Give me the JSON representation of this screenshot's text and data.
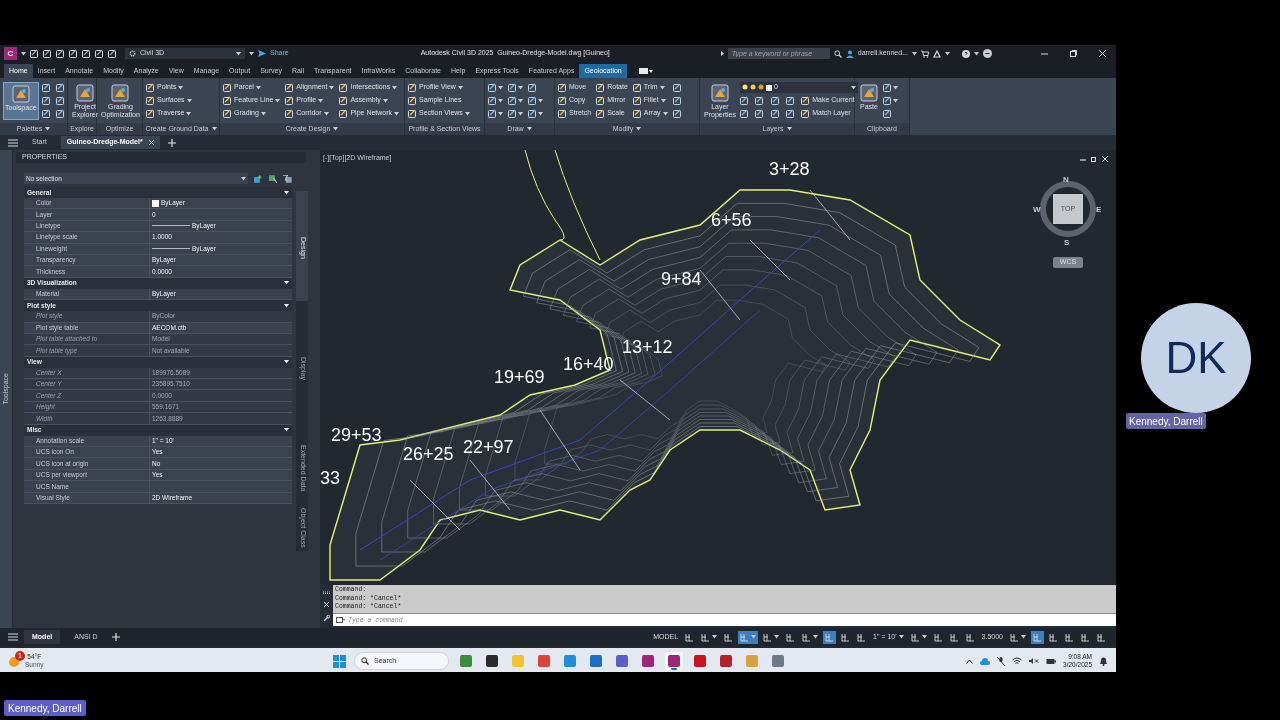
{
  "window": {
    "app_logo": "C",
    "workspace": "Civil 3D",
    "share": "Share",
    "title": "Autodesk Civil 3D 2025  Guineo-Dredge-Model.dwg [Guineo]",
    "search_placeholder": "Type a keyword or phrase",
    "user": "darrell.kenned..."
  },
  "ribbon_tabs": [
    {
      "label": "Home",
      "selected": true,
      "kind": "normal"
    },
    {
      "label": "Insert",
      "selected": false,
      "kind": "normal"
    },
    {
      "label": "Annotate",
      "selected": false,
      "kind": "normal"
    },
    {
      "label": "Modify",
      "selected": false,
      "kind": "normal"
    },
    {
      "label": "Analyze",
      "selected": false,
      "kind": "normal"
    },
    {
      "label": "View",
      "selected": false,
      "kind": "normal"
    },
    {
      "label": "Manage",
      "selected": false,
      "kind": "normal"
    },
    {
      "label": "Output",
      "selected": false,
      "kind": "normal"
    },
    {
      "label": "Survey",
      "selected": false,
      "kind": "normal"
    },
    {
      "label": "Rail",
      "selected": false,
      "kind": "normal"
    },
    {
      "label": "Transparent",
      "selected": false,
      "kind": "normal"
    },
    {
      "label": "InfraWorks",
      "selected": false,
      "kind": "normal"
    },
    {
      "label": "Collaborate",
      "selected": false,
      "kind": "normal"
    },
    {
      "label": "Help",
      "selected": false,
      "kind": "normal"
    },
    {
      "label": "Express Tools",
      "selected": false,
      "kind": "normal"
    },
    {
      "label": "Featured Apps",
      "selected": false,
      "kind": "normal"
    },
    {
      "label": "Geolocation",
      "selected": false,
      "kind": "contextual"
    }
  ],
  "ribbon_panels": [
    {
      "title": "Palettes",
      "dropdown": true,
      "kind": "tools",
      "large": [
        {
          "label": "Toolspace",
          "active": true
        }
      ],
      "items": [
        {
          "kind": "icon",
          "dropdown": false
        },
        {
          "kind": "icon",
          "dropdown": false
        },
        {
          "kind": "icon",
          "dropdown": false
        },
        {
          "kind": "icon",
          "dropdown": false
        },
        {
          "kind": "icon",
          "dropdown": false
        },
        {
          "kind": "icon",
          "dropdown": false
        }
      ]
    },
    {
      "title": "Explore",
      "dropdown": false,
      "kind": "tools",
      "large": [
        {
          "label": "Project Explorer",
          "active": false
        }
      ]
    },
    {
      "title": "Optimize",
      "dropdown": false,
      "kind": "tools",
      "large": [
        {
          "label": "Grading Optimization",
          "active": false
        }
      ]
    },
    {
      "title": "Create Ground Data",
      "dropdown": true,
      "kind": "tools",
      "items": [
        {
          "kind": "text",
          "label": "Points",
          "dropdown": true
        },
        {
          "kind": "text",
          "label": "Surfaces",
          "dropdown": true
        },
        {
          "kind": "text",
          "label": "Traverse",
          "dropdown": true
        }
      ]
    },
    {
      "title": "Create Design",
      "dropdown": true,
      "kind": "tools",
      "items": [
        {
          "kind": "text",
          "label": "Parcel",
          "dropdown": true
        },
        {
          "kind": "text",
          "label": "Feature Line",
          "dropdown": true
        },
        {
          "kind": "text",
          "label": "Grading",
          "dropdown": true
        },
        {
          "kind": "text",
          "label": "Alignment",
          "dropdown": true
        },
        {
          "kind": "text",
          "label": "Profile",
          "dropdown": true
        },
        {
          "kind": "text",
          "label": "Corridor",
          "dropdown": true
        },
        {
          "kind": "text",
          "label": "Intersections",
          "dropdown": true
        },
        {
          "kind": "text",
          "label": "Assembly",
          "dropdown": true
        },
        {
          "kind": "text",
          "label": "Pipe Network",
          "dropdown": true
        }
      ]
    },
    {
      "title": "Profile & Section Views",
      "dropdown": false,
      "kind": "tools",
      "items": [
        {
          "kind": "text",
          "label": "Profile View",
          "dropdown": true
        },
        {
          "kind": "text",
          "label": "Sample Lines",
          "dropdown": false
        },
        {
          "kind": "text",
          "label": "Section Views",
          "dropdown": true
        }
      ]
    },
    {
      "title": "Draw",
      "dropdown": true,
      "kind": "tools",
      "items": [
        {
          "kind": "icon",
          "dropdown": true
        },
        {
          "kind": "icon",
          "dropdown": true
        },
        {
          "kind": "icon",
          "dropdown": true
        },
        {
          "kind": "icon",
          "dropdown": true
        },
        {
          "kind": "icon",
          "dropdown": true
        },
        {
          "kind": "icon",
          "dropdown": true
        },
        {
          "kind": "icon",
          "dropdown": false
        },
        {
          "kind": "icon",
          "dropdown": true
        },
        {
          "kind": "icon",
          "dropdown": true
        }
      ]
    },
    {
      "title": "Modify",
      "dropdown": true,
      "kind": "tools",
      "items": [
        {
          "kind": "text",
          "label": "Move",
          "dropdown": false
        },
        {
          "kind": "text",
          "label": "Copy",
          "dropdown": false
        },
        {
          "kind": "text",
          "label": "Stretch",
          "dropdown": false
        },
        {
          "kind": "text",
          "label": "Rotate",
          "dropdown": false
        },
        {
          "kind": "text",
          "label": "Mirror",
          "dropdown": false
        },
        {
          "kind": "text",
          "label": "Scale",
          "dropdown": false
        },
        {
          "kind": "text",
          "label": "Trim",
          "dropdown": true
        },
        {
          "kind": "text",
          "label": "Fillet",
          "dropdown": true
        },
        {
          "kind": "text",
          "label": "Array",
          "dropdown": true
        },
        {
          "kind": "icon",
          "dropdown": false
        },
        {
          "kind": "icon",
          "dropdown": false
        },
        {
          "kind": "icon",
          "dropdown": false
        }
      ]
    },
    {
      "title": "Layers",
      "dropdown": true,
      "kind": "layers",
      "combo": "0",
      "large": [
        {
          "label": "Layer Properties",
          "active": false
        }
      ],
      "items": [
        {
          "kind": "icon",
          "dropdown": false
        },
        {
          "kind": "icon",
          "dropdown": false
        },
        {
          "kind": "icon",
          "dropdown": false
        },
        {
          "kind": "icon",
          "dropdown": false
        },
        {
          "kind": "icon",
          "dropdown": false
        },
        {
          "kind": "icon",
          "dropdown": false
        },
        {
          "kind": "icon",
          "dropdown": false
        },
        {
          "kind": "icon",
          "dropdown": false
        },
        {
          "kind": "text",
          "label": "Make Current",
          "dropdown": false
        },
        {
          "kind": "text",
          "label": "Match Layer",
          "dropdown": false
        }
      ]
    },
    {
      "title": "Clipboard",
      "dropdown": false,
      "kind": "tools",
      "large": [
        {
          "label": "Paste",
          "active": false
        }
      ],
      "items": [
        {
          "kind": "icon",
          "dropdown": true
        },
        {
          "kind": "icon",
          "dropdown": true
        },
        {
          "kind": "icon",
          "dropdown": false
        }
      ]
    }
  ],
  "file_tabs": [
    {
      "label": "Start",
      "selected": false
    },
    {
      "label": "Guineo-Dredge-Model*",
      "selected": true
    }
  ],
  "toolspace_label": "Toolspace",
  "properties": {
    "title": "PROPERTIES",
    "selection": "No selection",
    "sections": [
      {
        "title": "General",
        "rows": [
          {
            "name": "Color",
            "value": "ByLayer",
            "kind": "color",
            "disabled": false
          },
          {
            "name": "Layer",
            "value": "0",
            "kind": "text",
            "disabled": false
          },
          {
            "name": "Linetype",
            "value": "ByLayer",
            "kind": "line",
            "disabled": false
          },
          {
            "name": "Linetype scale",
            "value": "1.0000",
            "kind": "text",
            "disabled": false
          },
          {
            "name": "Lineweight",
            "value": "ByLayer",
            "kind": "line",
            "disabled": false
          },
          {
            "name": "Transparency",
            "value": "ByLayer",
            "kind": "text",
            "disabled": false
          },
          {
            "name": "Thickness",
            "value": "0.0000",
            "kind": "text",
            "disabled": false
          }
        ]
      },
      {
        "title": "3D Visualization",
        "rows": [
          {
            "name": "Material",
            "value": "ByLayer",
            "kind": "text",
            "disabled": false
          }
        ]
      },
      {
        "title": "Plot style",
        "rows": [
          {
            "name": "Plot style",
            "value": "ByColor",
            "kind": "text",
            "disabled": true
          },
          {
            "name": "Plot style table",
            "value": "AECOM.ctb",
            "kind": "text",
            "disabled": false
          },
          {
            "name": "Plot table attached to",
            "value": "Model",
            "kind": "text",
            "disabled": true
          },
          {
            "name": "Plot table type",
            "value": "Not available",
            "kind": "text",
            "disabled": true
          }
        ]
      },
      {
        "title": "View",
        "rows": [
          {
            "name": "Center X",
            "value": "189976.5089",
            "kind": "text",
            "disabled": true
          },
          {
            "name": "Center Y",
            "value": "235895.7510",
            "kind": "text",
            "disabled": true
          },
          {
            "name": "Center Z",
            "value": "0.0000",
            "kind": "text",
            "disabled": true
          },
          {
            "name": "Height",
            "value": "559.1671",
            "kind": "text",
            "disabled": true
          },
          {
            "name": "Width",
            "value": "1263.8889",
            "kind": "text",
            "disabled": true
          }
        ]
      },
      {
        "title": "Misc",
        "rows": [
          {
            "name": "Annotation scale",
            "value": "1\" = 10'",
            "kind": "text",
            "disabled": false
          },
          {
            "name": "UCS icon On",
            "value": "Yes",
            "kind": "text",
            "disabled": false
          },
          {
            "name": "UCS icon at origin",
            "value": "No",
            "kind": "text",
            "disabled": false
          },
          {
            "name": "UCS per viewport",
            "value": "Yes",
            "kind": "text",
            "disabled": false
          },
          {
            "name": "UCS Name",
            "kind": "text",
            "disabled": false
          },
          {
            "name": "Visual Style",
            "value": "2D Wireframe",
            "kind": "text",
            "disabled": false
          }
        ]
      }
    ],
    "side_tabs": [
      {
        "label": "Design",
        "selected": true
      },
      {
        "label": "Display",
        "selected": false
      },
      {
        "label": "Extended Data",
        "selected": false
      },
      {
        "label": "Object Class",
        "selected": false
      }
    ]
  },
  "viewport": {
    "label": "[-][Top][2D Wireframe]",
    "stations": [
      "3+28",
      "6+56",
      "9+84",
      "13+12",
      "16+40",
      "19+69",
      "29+53",
      "26+25",
      "22+97",
      "33"
    ],
    "viewcube": {
      "north": "N",
      "east": "E",
      "south": "S",
      "west": "W",
      "face": "TOP",
      "ucs": "WCS"
    }
  },
  "command_line": {
    "history": [
      "Command:",
      "Command: *Cancel*",
      "Command: *Cancel*"
    ],
    "placeholder": "Type a command"
  },
  "layout_tabs": [
    {
      "label": "Model",
      "selected": true
    },
    {
      "label": "ANSI D",
      "selected": false
    }
  ],
  "status_bar": [
    {
      "kind": "text",
      "label": "MODEL",
      "on": false,
      "dropdown": false
    },
    {
      "kind": "icon",
      "on": false,
      "dropdown": false
    },
    {
      "kind": "icon",
      "on": false,
      "dropdown": true
    },
    {
      "kind": "icon",
      "on": false,
      "dropdown": false
    },
    {
      "kind": "icon",
      "on": true,
      "dropdown": true
    },
    {
      "kind": "icon",
      "on": false,
      "dropdown": true
    },
    {
      "kind": "icon",
      "on": false,
      "dropdown": false
    },
    {
      "kind": "icon",
      "on": false,
      "dropdown": true
    },
    {
      "kind": "icon",
      "on": true,
      "dropdown": false
    },
    {
      "kind": "icon",
      "on": false,
      "dropdown": false
    },
    {
      "kind": "icon",
      "on": false,
      "dropdown": false
    },
    {
      "kind": "text",
      "label": "1\" = 10'",
      "on": false,
      "dropdown": true
    },
    {
      "kind": "icon",
      "on": false,
      "dropdown": true
    },
    {
      "kind": "icon",
      "on": false,
      "dropdown": false
    },
    {
      "kind": "icon",
      "on": false,
      "dropdown": false
    },
    {
      "kind": "icon",
      "on": false,
      "dropdown": false
    },
    {
      "kind": "text",
      "label": "3.5000",
      "on": false,
      "dropdown": false
    },
    {
      "kind": "icon",
      "on": false,
      "dropdown": true
    },
    {
      "kind": "icon",
      "on": true,
      "dropdown": false
    },
    {
      "kind": "icon",
      "on": false,
      "dropdown": false
    },
    {
      "kind": "icon",
      "on": false,
      "dropdown": false
    },
    {
      "kind": "icon",
      "on": false,
      "dropdown": false
    },
    {
      "kind": "icon",
      "on": false,
      "dropdown": false
    }
  ],
  "taskbar": {
    "weather": {
      "temperature": "54°F",
      "condition": "Sunny",
      "badge": "1"
    },
    "search": "Search",
    "apps": [
      {
        "color": "#3c8d3f",
        "selected": false
      },
      {
        "color": "#2b2b2b",
        "selected": false
      },
      {
        "color": "#f2c234",
        "selected": false
      },
      {
        "color": "#db4437",
        "selected": false
      },
      {
        "color": "#1f8fd8",
        "selected": false
      },
      {
        "color": "#1a6fc4",
        "selected": false
      },
      {
        "color": "#5b5fc7",
        "selected": false
      },
      {
        "color": "#a0267a",
        "selected": false
      },
      {
        "color": "#a0267a",
        "selected": true
      },
      {
        "color": "#c4161c",
        "selected": false
      },
      {
        "color": "#b5232a",
        "selected": false
      },
      {
        "color": "#d9a23c",
        "selected": false
      },
      {
        "color": "#6b7a8c",
        "selected": false
      }
    ],
    "time": "9:08 AM",
    "date": "3/20/2025"
  },
  "meeting": {
    "initials": "DK",
    "participant": "Kennedy, Darrell",
    "presenter": "Kennedy, Darrell"
  }
}
